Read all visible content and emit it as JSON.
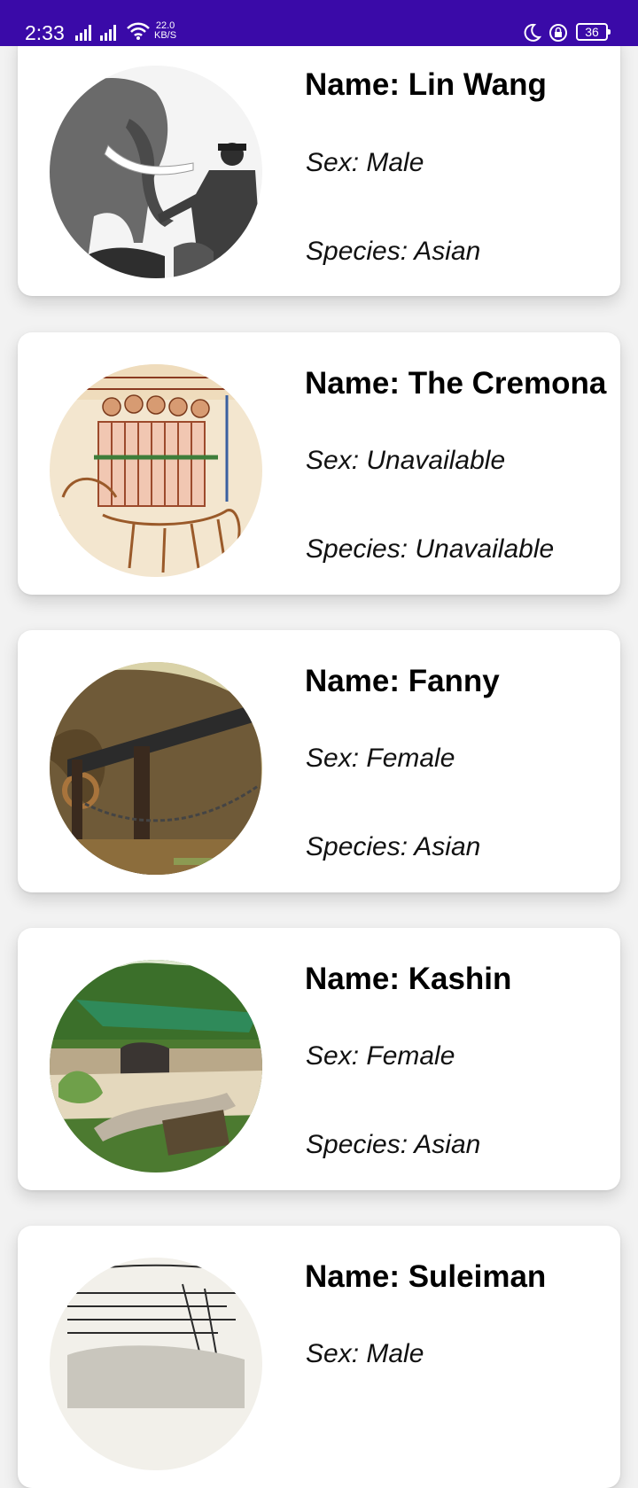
{
  "status_bar": {
    "time": "2:33",
    "net_speed_value": "22.0",
    "net_speed_unit": "KB/S",
    "battery": "36"
  },
  "elephants": [
    {
      "name": "Name: Lin Wang",
      "sex": "Sex: Male",
      "species": "Species: Asian"
    },
    {
      "name": "Name: The Cremona",
      "sex": "Sex: Unavailable",
      "species": "Species: Unavailable"
    },
    {
      "name": "Name: Fanny",
      "sex": "Sex: Female",
      "species": "Species: Asian"
    },
    {
      "name": "Name: Kashin",
      "sex": "Sex: Female",
      "species": "Species: Asian"
    },
    {
      "name": "Name: Suleiman",
      "sex": "Sex: Male",
      "species": ""
    }
  ]
}
